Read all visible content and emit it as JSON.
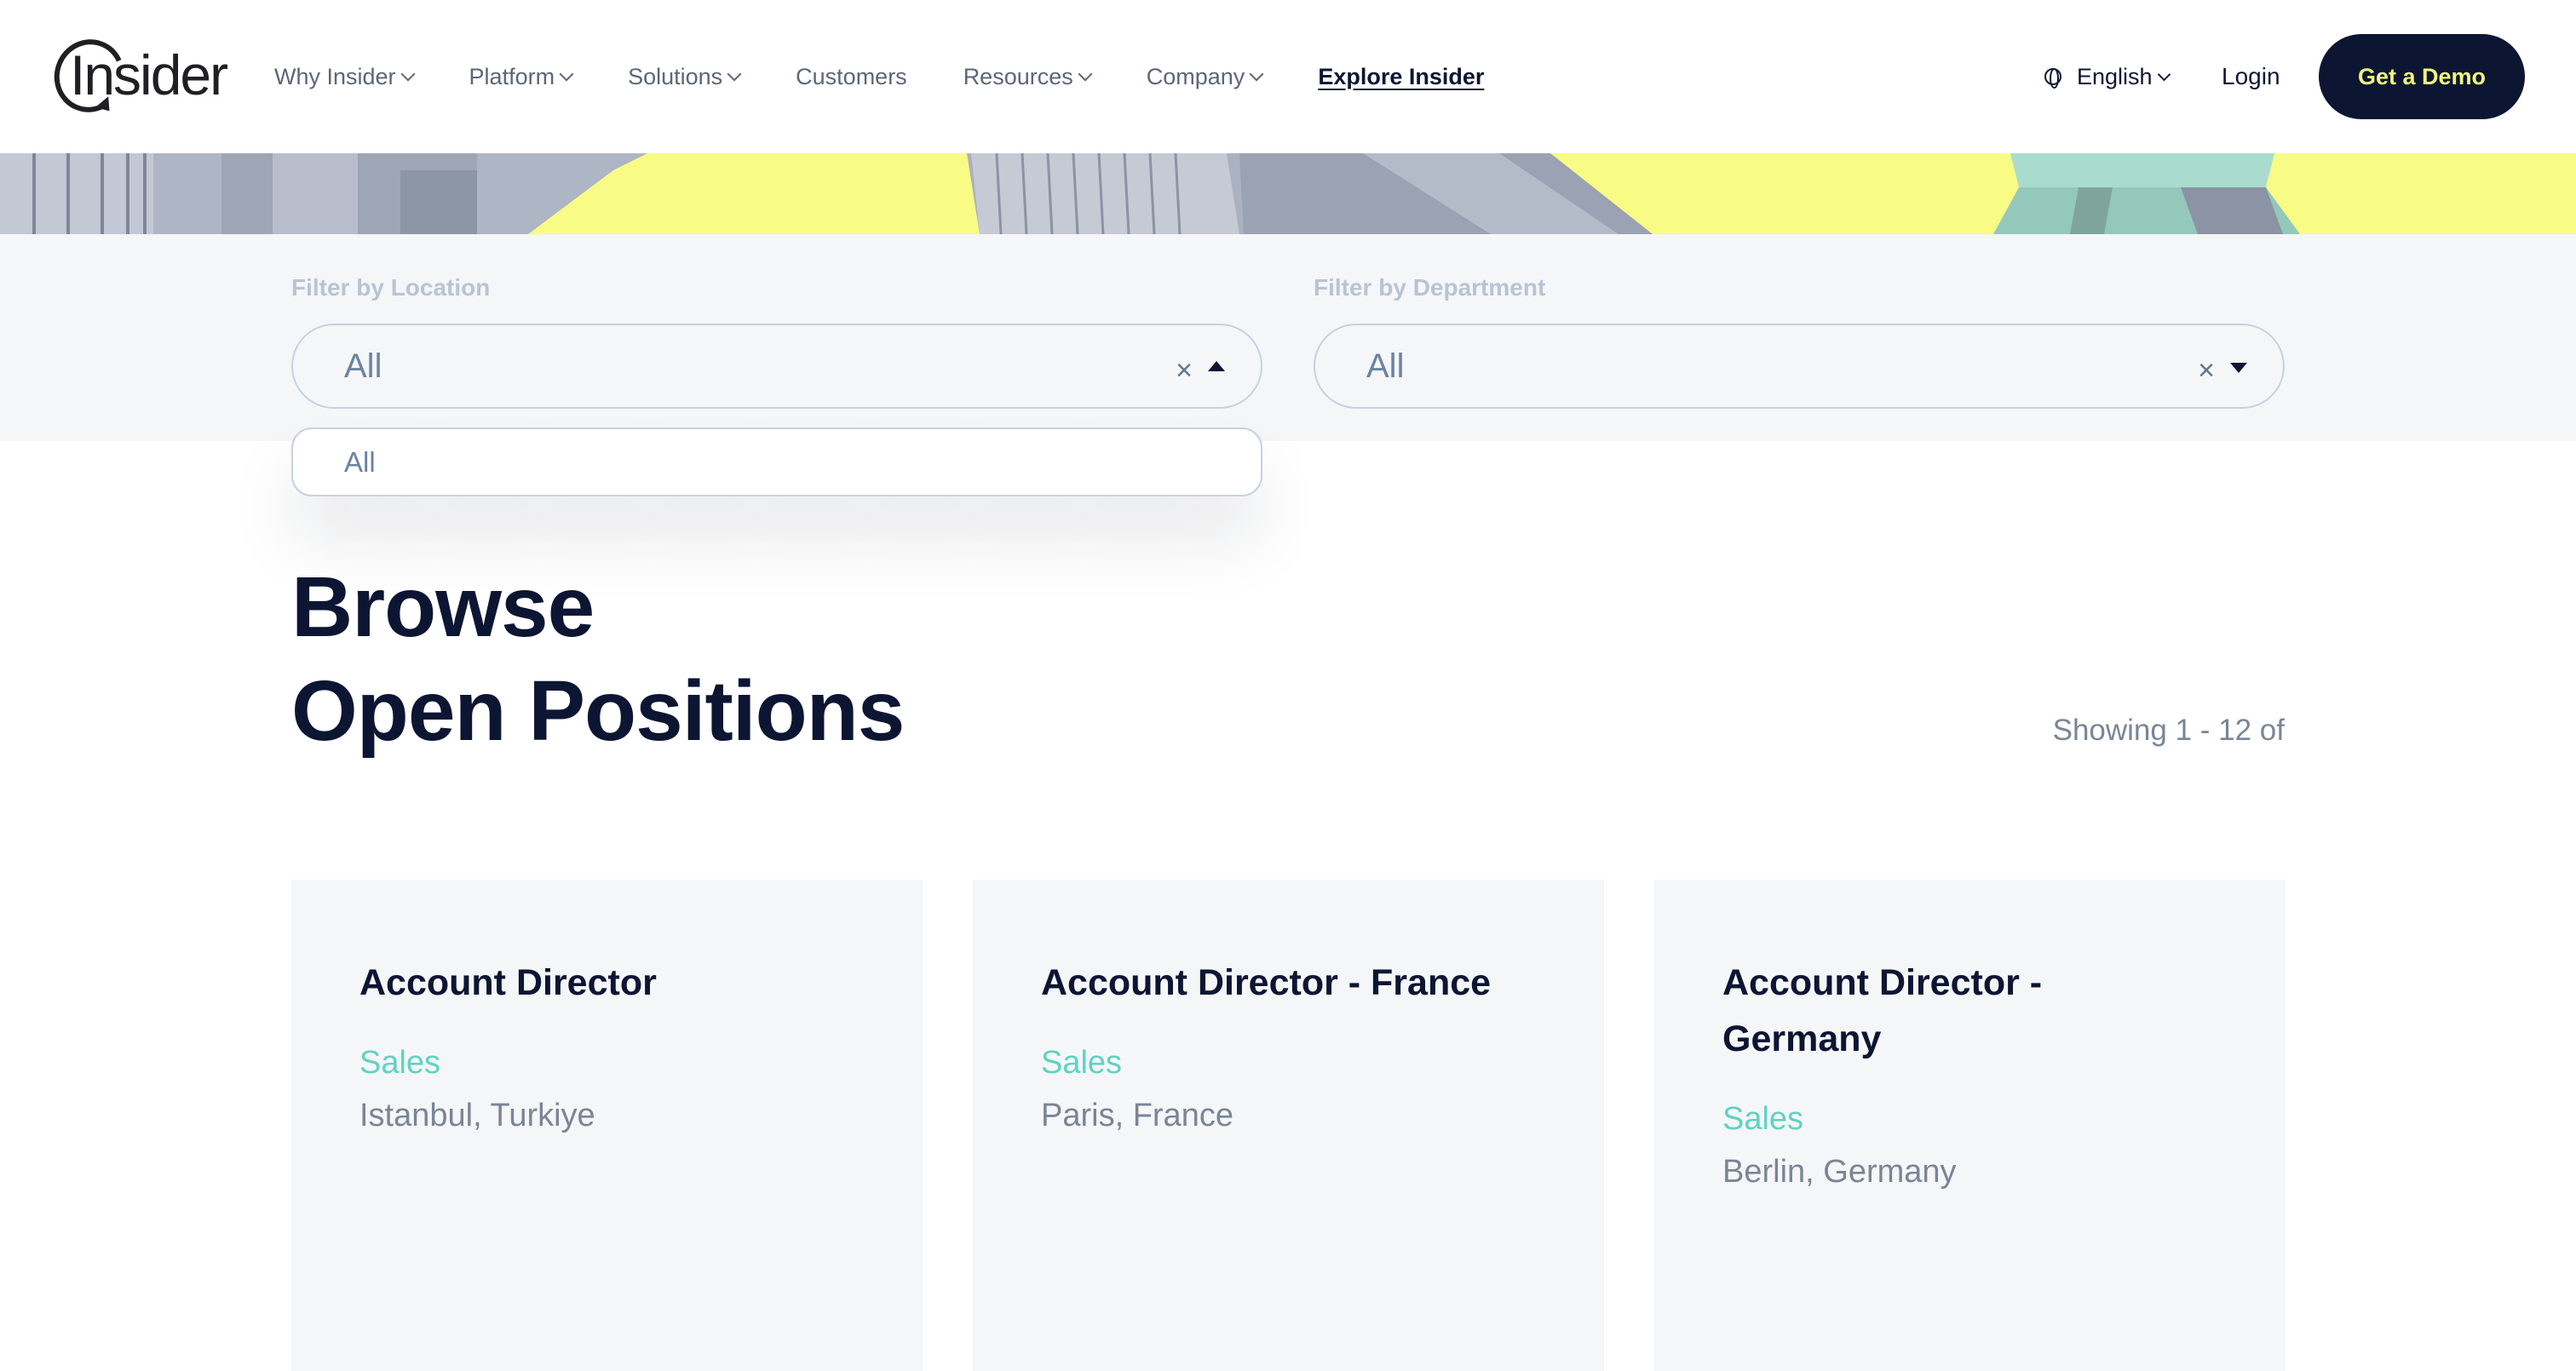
{
  "header": {
    "logo_text": "Insider",
    "nav": [
      {
        "label": "Why Insider",
        "has_dropdown": true
      },
      {
        "label": "Platform",
        "has_dropdown": true
      },
      {
        "label": "Solutions",
        "has_dropdown": true
      },
      {
        "label": "Customers",
        "has_dropdown": false
      },
      {
        "label": "Resources",
        "has_dropdown": true
      },
      {
        "label": "Company",
        "has_dropdown": true
      },
      {
        "label": "Explore Insider",
        "has_dropdown": false
      }
    ],
    "language": "English",
    "login": "Login",
    "cta": "Get a Demo"
  },
  "filters": {
    "location": {
      "label": "Filter by Location",
      "value": "All",
      "clear_icon": "×",
      "open": true
    },
    "department": {
      "label": "Filter by Department",
      "value": "All",
      "clear_icon": "×",
      "open": false
    },
    "location_options": [
      "All"
    ]
  },
  "main": {
    "title_line1": "Browse",
    "title_line2": "Open Positions",
    "showing": "Showing 1 - 12 of"
  },
  "jobs": [
    {
      "title": "Account Director",
      "department": "Sales",
      "location": "Istanbul, Turkiye"
    },
    {
      "title": "Account Director - France",
      "department": "Sales",
      "location": "Paris, France"
    },
    {
      "title": "Account Director - Germany",
      "department": "Sales",
      "location": "Berlin, Germany"
    }
  ],
  "colors": {
    "navy": "#0c1633",
    "accent_yellow": "#f2f77a",
    "hero_yellow": "#f8fb84",
    "teal": "#5ed3c3",
    "muted": "#7a8596"
  },
  "icons": {
    "language": "globe-icon",
    "dropdown": "chevron-down-icon",
    "clear": "close-icon",
    "open": "caret-up-icon",
    "closed": "caret-down-icon"
  }
}
